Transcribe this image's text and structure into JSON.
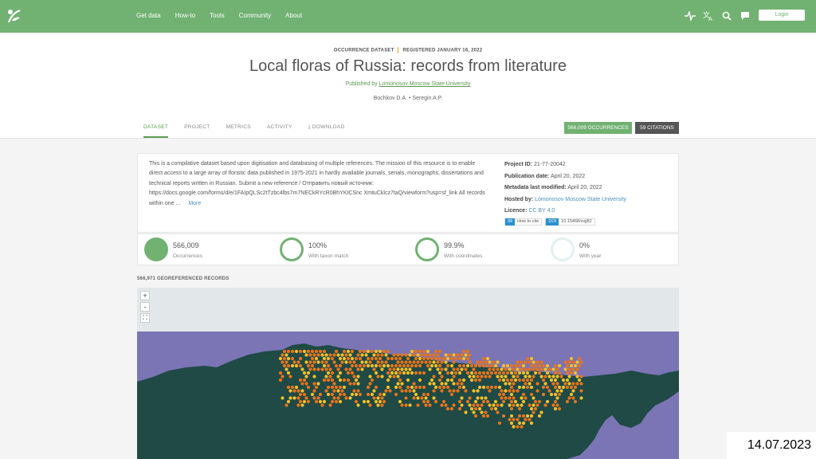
{
  "nav": {
    "links": [
      "Get data",
      "How-to",
      "Tools",
      "Community",
      "About"
    ],
    "login": "Login",
    "icons": [
      "activity-icon",
      "translate-icon",
      "search-icon",
      "chat-icon"
    ]
  },
  "dataset": {
    "type": "OCCURRENCE DATASET",
    "registered": "REGISTERED JANUARY 16, 2022",
    "title": "Local floras of Russia: records from literature",
    "published_prefix": "Published by",
    "publisher": "Lomonosov Moscow State University",
    "authors": "Bochkov D.A. • Seregin A.P."
  },
  "tabs": [
    "DATASET",
    "PROJECT",
    "METRICS",
    "ACTIVITY",
    "DOWNLOAD"
  ],
  "active_tab": "DATASET",
  "badges": {
    "occurrences": "566,009 OCCURRENCES",
    "citations": "59 CITATIONS"
  },
  "description": {
    "text": "This is a compilative dataset based upon digitisation and databasing of multiple references. The mission of this resource is to enable direct access to a large array of floristic data published in 1975-2021 in hardly available journals, serials, monographs, dissertations and technical reports written in Russian. Submit a new reference / Отправить новый источник: https://docs.google.com/forms/d/e/1FAIpQLSc2tTzbc4lbs7m7NECkRYcR0BhYKICSnc XmtuCklcz7taQ/viewform?usp=sf_link All records within one ...",
    "more": "More"
  },
  "meta": {
    "project_id_label": "Project ID:",
    "project_id": "21-77-20042",
    "pub_date_label": "Publication date:",
    "pub_date": "April 20, 2022",
    "modified_label": "Metadata last modified:",
    "modified": "April 20, 2022",
    "hosted_label": "Hosted by:",
    "hosted": "Lomonosov Moscow State University",
    "licence_label": "Licence:",
    "licence": "CC BY 4.0",
    "cite_tag": "99",
    "cite_text": "How to cite",
    "doi_tag": "DOI",
    "doi": "10.15468/xvjj82"
  },
  "stats": [
    {
      "value": "566,009",
      "label": "Occurrences",
      "fill": 1.0
    },
    {
      "value": "100%",
      "label": "With taxon match",
      "fill": 1.0
    },
    {
      "value": "99.9%",
      "label": "With coordinates",
      "fill": 0.999
    },
    {
      "value": "0%",
      "label": "With year",
      "fill": 0.0
    }
  ],
  "georef_label": "566,971 GEOREFERENCED RECORDS",
  "map": {
    "zoom_in": "+",
    "zoom_out": "-",
    "fullscreen": "⛶",
    "colors": {
      "sea": "#7b74b5",
      "land": "#1f4a45",
      "hex_low": "#e8741a",
      "hex_high": "#f5c028"
    }
  },
  "date_stamp": "14.07.2023"
}
